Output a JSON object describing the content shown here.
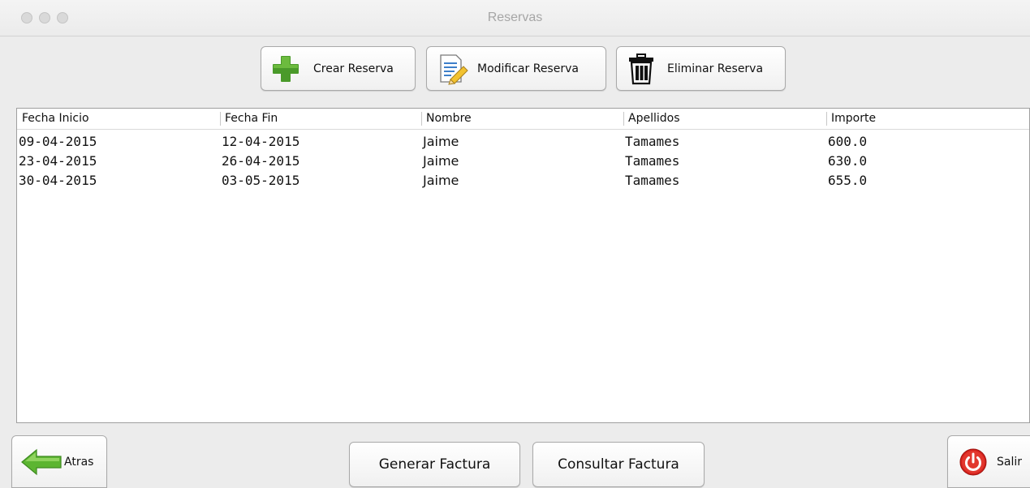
{
  "window": {
    "title": "Reservas"
  },
  "toolbar": {
    "create_label": "Crear Reserva",
    "modify_label": "Modificar Reserva",
    "delete_label": "Eliminar Reserva"
  },
  "table": {
    "columns": [
      "Fecha Inicio",
      "Fecha Fin",
      "Nombre",
      "Apellidos",
      "Importe"
    ],
    "rows": [
      [
        "09-04-2015",
        "12-04-2015",
        "Jaime",
        "Tamames",
        "600.0"
      ],
      [
        "23-04-2015",
        "26-04-2015",
        "Jaime",
        "Tamames",
        "630.0"
      ],
      [
        "30-04-2015",
        "03-05-2015",
        "Jaime",
        "Tamames",
        "655.0"
      ]
    ]
  },
  "footer": {
    "back_label": "Atras",
    "generate_label": "Generar Factura",
    "consult_label": "Consultar Factura",
    "exit_label": "Salir"
  },
  "colors": {
    "plus_green": "#4a9a2a",
    "arrow_green": "#5cb531",
    "power_red": "#d5211c"
  }
}
